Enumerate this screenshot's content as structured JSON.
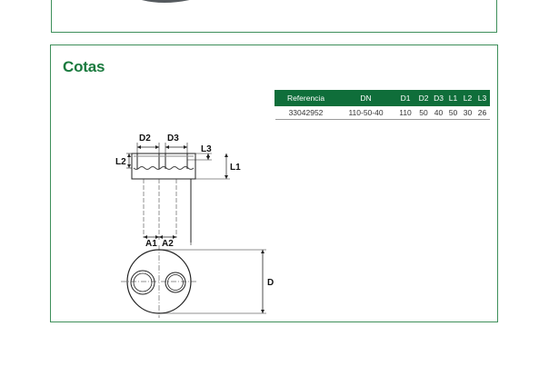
{
  "section": {
    "title": "Cotas"
  },
  "table": {
    "headers": [
      "Referencia",
      "DN",
      "D1",
      "D2",
      "D3",
      "L1",
      "L2",
      "L3"
    ],
    "rows": [
      [
        "33042952",
        "110-50-40",
        "110",
        "50",
        "40",
        "50",
        "30",
        "26"
      ]
    ]
  },
  "diagram": {
    "labels": {
      "d2": "D2",
      "d3": "D3",
      "l1": "L1",
      "l2": "L2",
      "l3": "L3",
      "a1": "A1",
      "a2": "A2",
      "d": "D"
    }
  },
  "colors": {
    "accent": "#1a7a3e",
    "table_header": "#0f6e3a",
    "panel_border": "#3e8f5a"
  }
}
